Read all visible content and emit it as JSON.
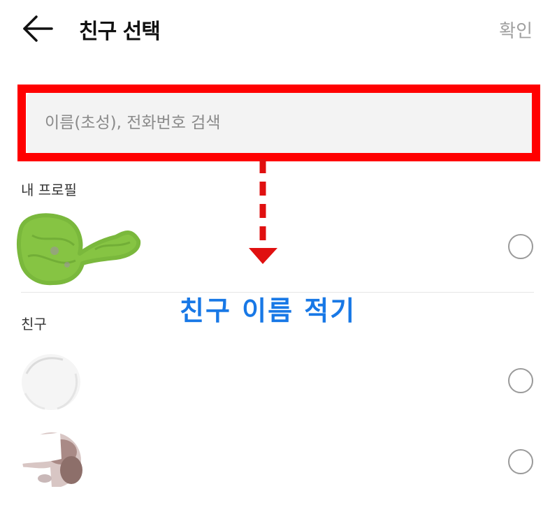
{
  "header": {
    "back_icon": "arrow-left-icon",
    "title": "친구 선택",
    "confirm_label": "확인"
  },
  "search": {
    "placeholder": "이름(초성), 전화번호 검색",
    "value": ""
  },
  "sections": {
    "my_profile_label": "내 프로필",
    "friends_label": "친구"
  },
  "annotation": {
    "text": "친구 이름 적기",
    "color": "#1878e6",
    "highlight_color": "#ff0000"
  },
  "friends": [
    {
      "selected": false
    },
    {
      "selected": false
    }
  ],
  "my_profile": {
    "selected": false
  }
}
